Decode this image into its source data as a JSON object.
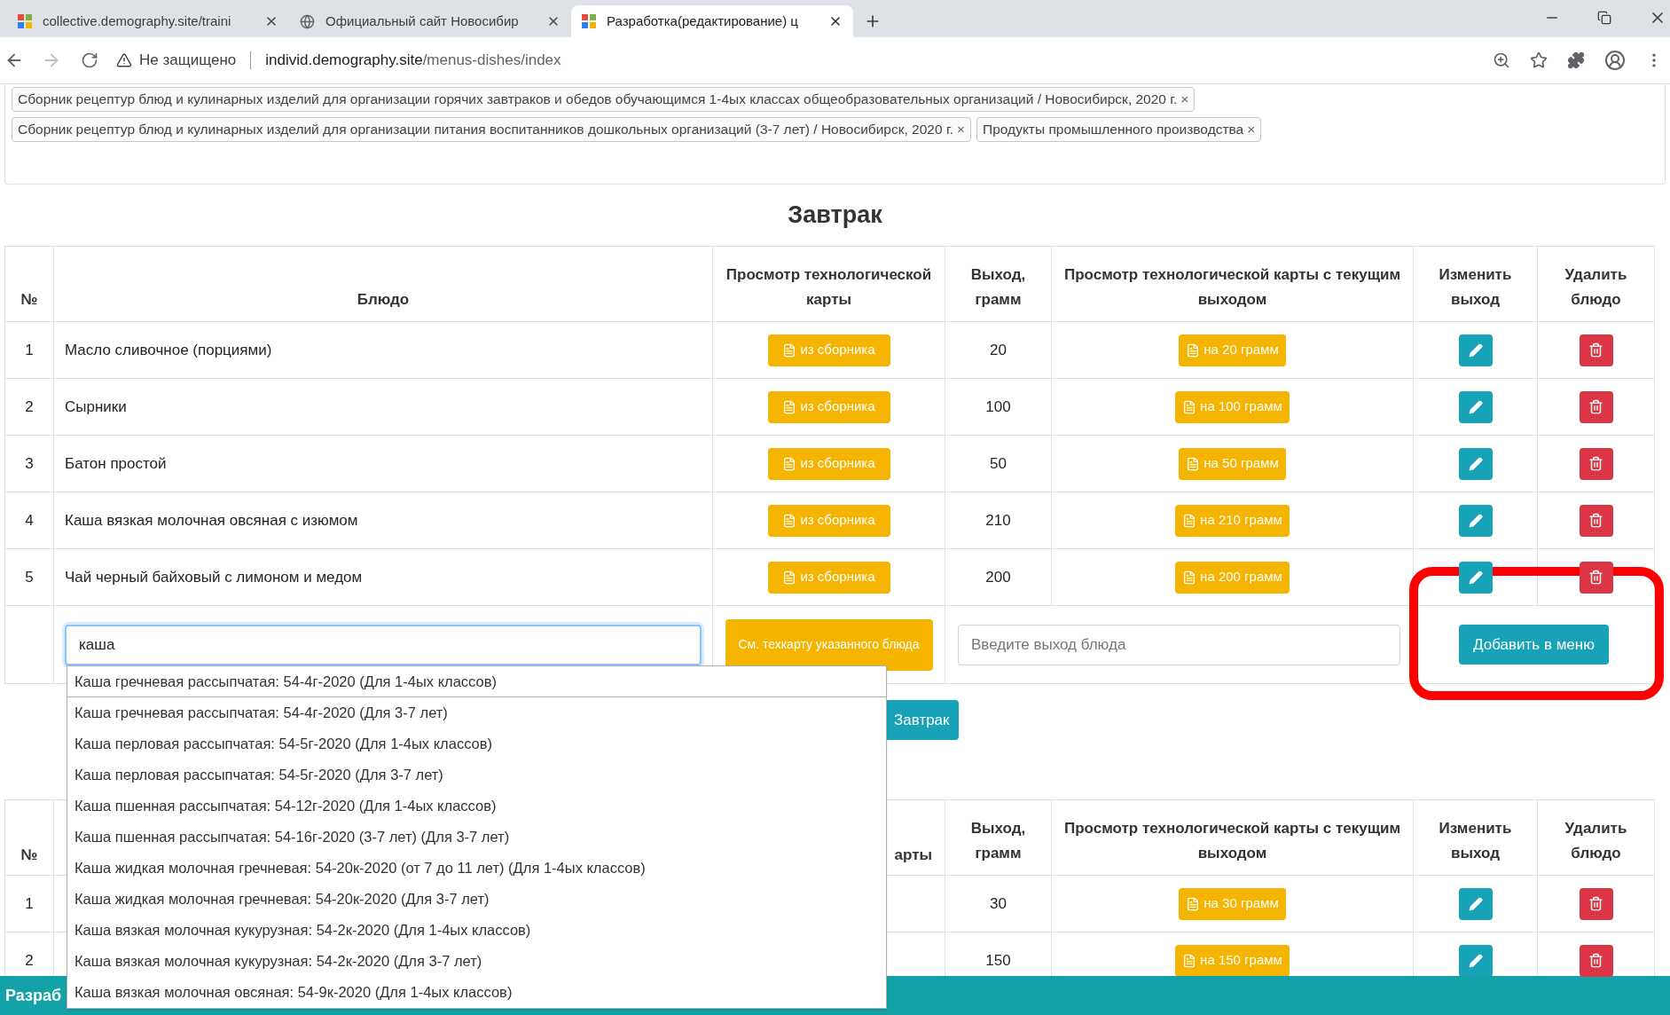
{
  "browser": {
    "tabs": [
      {
        "title": "collective.demography.site/traini",
        "kind": "tiles",
        "selected": false
      },
      {
        "title": "Официальный сайт Новосибир",
        "kind": "globe",
        "selected": false
      },
      {
        "title": "Разработка(редактирование) ц",
        "kind": "tiles",
        "selected": true
      }
    ],
    "security_label": "Не защищено",
    "url_host": "individ.demography.site",
    "url_path": "/menus-dishes/index"
  },
  "filter_tag_rows": [
    [
      {
        "label": "Сборник рецептур блюд и кулинарных изделий для организации горячих завтраков и обедов обучающимся 1-4ых классах общеобразовательных организаций / Новосибирск, 2020 г.",
        "remove": "×"
      }
    ],
    [
      {
        "label": "Сборник рецептур блюд и кулинарных изделий для организации питания воспитанников дошкольных организаций (3-7 лет) / Новосибирск, 2020 г.",
        "remove": "×"
      },
      {
        "label": "Продукты промышленного производства",
        "remove": "×"
      }
    ]
  ],
  "meal_title": "Завтрак",
  "table": {
    "columns": [
      "№",
      "Блюдо",
      "Просмотр технологической карты",
      "Выход, грамм",
      "Просмотр технологической карты с текущим выходом",
      "Изменить выход",
      "Удалить блюдо"
    ],
    "rows": [
      {
        "number": "1",
        "dish": "Масло сливочное (порциями)",
        "card_button": "из сборника",
        "output": "20",
        "current_card_button": "на 20 грамм"
      },
      {
        "number": "2",
        "dish": "Сырники",
        "card_button": "из сборника",
        "output": "100",
        "current_card_button": "на 100 грамм"
      },
      {
        "number": "3",
        "dish": "Батон простой",
        "card_button": "из сборника",
        "output": "50",
        "current_card_button": "на 50 грамм"
      },
      {
        "number": "4",
        "dish": "Каша вязкая молочная овсяная с изюмом",
        "card_button": "из сборника",
        "output": "210",
        "current_card_button": "на 210 грамм"
      },
      {
        "number": "5",
        "dish": "Чай черный байховый с лимоном и медом",
        "card_button": "из сборника",
        "output": "200",
        "current_card_button": "на 200 грамм"
      }
    ],
    "add_row": {
      "dish_value": "каша",
      "card_button": "См. техкарту указанного блюда",
      "output_placeholder": "Введите выход блюда",
      "add_button": "Добавить в меню"
    }
  },
  "suggestions": [
    "Каша гречневая рассыпчатая: 54-4г-2020 (Для 1-4ых классов)",
    "Каша гречневая рассыпчатая: 54-4г-2020 (Для 3-7 лет)",
    "Каша перловая рассыпчатая: 54-5г-2020 (Для 1-4ых классов)",
    "Каша перловая рассыпчатая: 54-5г-2020 (Для 3-7 лет)",
    "Каша пшенная рассыпчатая: 54-12г-2020 (Для 1-4ых классов)",
    "Каша пшенная рассыпчатая: 54-16г-2020 (3-7 лет) (Для 3-7 лет)",
    "Каша жидкая молочная гречневая: 54-20к-2020 (от 7 до 11 лет) (Для 1-4ых классов)",
    "Каша жидкая молочная гречневая: 54-20к-2020 (Для 3-7 лет)",
    "Каша вязкая молочная кукурузная: 54-2к-2020 (Для 1-4ых классов)",
    "Каша вязкая молочная кукурузная: 54-2к-2020 (Для 3-7 лет)",
    "Каша вязкая молочная овсяная: 54-9к-2020 (Для 1-4ых классов)"
  ],
  "meal_button": "Завтрак",
  "table2": {
    "columns": [
      "№",
      "арты",
      "Выход, грамм",
      "Просмотр технологической карты с текущим выходом",
      "Изменить выход",
      "Удалить блюдо"
    ],
    "rows": [
      {
        "number": "1",
        "output": "30",
        "current_card_button": "на 30 грамм"
      },
      {
        "number": "2",
        "output": "150",
        "current_card_button": "на 150 грамм"
      }
    ]
  },
  "footer_text": "Разраб"
}
